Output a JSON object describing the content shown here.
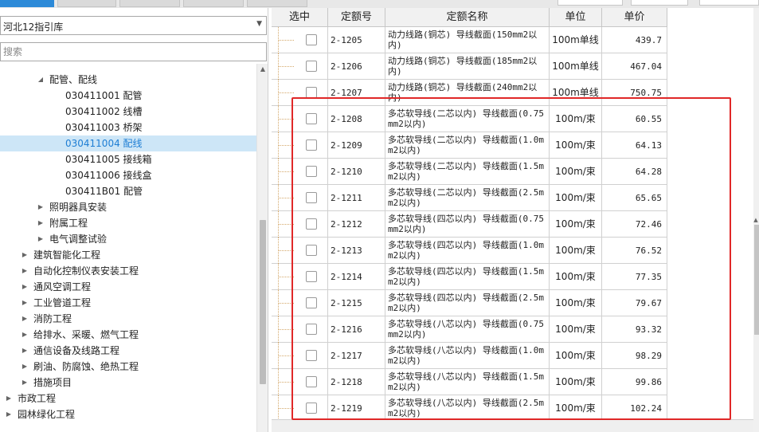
{
  "colors": {
    "accent": "#2d8ad8",
    "selection_bg": "#cde6f7",
    "selection_text": "#1e7ed4",
    "highlight_border": "#e02828"
  },
  "library": {
    "selected": "河北12指引库",
    "search_placeholder": "搜索"
  },
  "tree": [
    {
      "label": "配管、配线",
      "toggle": "expanded"
    },
    {
      "label": "030411001  配管",
      "toggle": "none"
    },
    {
      "label": "030411002  线槽",
      "toggle": "none"
    },
    {
      "label": "030411003  桥架",
      "toggle": "none"
    },
    {
      "label": "030411004  配线",
      "toggle": "none",
      "selected": true
    },
    {
      "label": "030411005  接线箱",
      "toggle": "none"
    },
    {
      "label": "030411006  接线盒",
      "toggle": "none"
    },
    {
      "label": "030411B01  配管",
      "toggle": "none"
    },
    {
      "label": "照明器具安装",
      "toggle": "collapsed"
    },
    {
      "label": "附属工程",
      "toggle": "collapsed"
    },
    {
      "label": "电气调整试验",
      "toggle": "collapsed"
    },
    {
      "label": "建筑智能化工程",
      "toggle": "collapsed"
    },
    {
      "label": "自动化控制仪表安装工程",
      "toggle": "collapsed"
    },
    {
      "label": "通风空调工程",
      "toggle": "collapsed"
    },
    {
      "label": "工业管道工程",
      "toggle": "collapsed"
    },
    {
      "label": "消防工程",
      "toggle": "collapsed"
    },
    {
      "label": "给排水、采暖、燃气工程",
      "toggle": "collapsed"
    },
    {
      "label": "通信设备及线路工程",
      "toggle": "collapsed"
    },
    {
      "label": "刷油、防腐蚀、绝热工程",
      "toggle": "collapsed"
    },
    {
      "label": "措施项目",
      "toggle": "collapsed"
    },
    {
      "label": "市政工程",
      "toggle": "collapsed"
    },
    {
      "label": "园林绿化工程",
      "toggle": "collapsed"
    }
  ],
  "grid": {
    "headers": {
      "select": "选中",
      "code": "定额号",
      "name": "定额名称",
      "unit": "单位",
      "price": "单价"
    },
    "rows": [
      {
        "code": "2-1205",
        "name": "动力线路(铜芯) 导线截面(150mm2以内)",
        "unit": "100m单线",
        "price": "439.7"
      },
      {
        "code": "2-1206",
        "name": "动力线路(铜芯) 导线截面(185mm2以内)",
        "unit": "100m单线",
        "price": "467.04"
      },
      {
        "code": "2-1207",
        "name": "动力线路(铜芯) 导线截面(240mm2以内)",
        "unit": "100m单线",
        "price": "750.75"
      },
      {
        "code": "2-1208",
        "name": "多芯软导线(二芯以内) 导线截面(0.75mm2以内)",
        "unit": "100m/束",
        "price": "60.55"
      },
      {
        "code": "2-1209",
        "name": "多芯软导线(二芯以内) 导线截面(1.0mm2以内)",
        "unit": "100m/束",
        "price": "64.13"
      },
      {
        "code": "2-1210",
        "name": "多芯软导线(二芯以内) 导线截面(1.5mm2以内)",
        "unit": "100m/束",
        "price": "64.28"
      },
      {
        "code": "2-1211",
        "name": "多芯软导线(二芯以内) 导线截面(2.5mm2以内)",
        "unit": "100m/束",
        "price": "65.65"
      },
      {
        "code": "2-1212",
        "name": "多芯软导线(四芯以内) 导线截面(0.75mm2以内)",
        "unit": "100m/束",
        "price": "72.46"
      },
      {
        "code": "2-1213",
        "name": "多芯软导线(四芯以内) 导线截面(1.0mm2以内)",
        "unit": "100m/束",
        "price": "76.52"
      },
      {
        "code": "2-1214",
        "name": "多芯软导线(四芯以内) 导线截面(1.5mm2以内)",
        "unit": "100m/束",
        "price": "77.35"
      },
      {
        "code": "2-1215",
        "name": "多芯软导线(四芯以内) 导线截面(2.5mm2以内)",
        "unit": "100m/束",
        "price": "79.67"
      },
      {
        "code": "2-1216",
        "name": "多芯软导线(八芯以内) 导线截面(0.75mm2以内)",
        "unit": "100m/束",
        "price": "93.32"
      },
      {
        "code": "2-1217",
        "name": "多芯软导线(八芯以内) 导线截面(1.0mm2以内)",
        "unit": "100m/束",
        "price": "98.29"
      },
      {
        "code": "2-1218",
        "name": "多芯软导线(八芯以内) 导线截面(1.5mm2以内)",
        "unit": "100m/束",
        "price": "99.86"
      },
      {
        "code": "2-1219",
        "name": "多芯软导线(八芯以内) 导线截面(2.5mm2以内)",
        "unit": "100m/束",
        "price": "102.24"
      }
    ]
  }
}
